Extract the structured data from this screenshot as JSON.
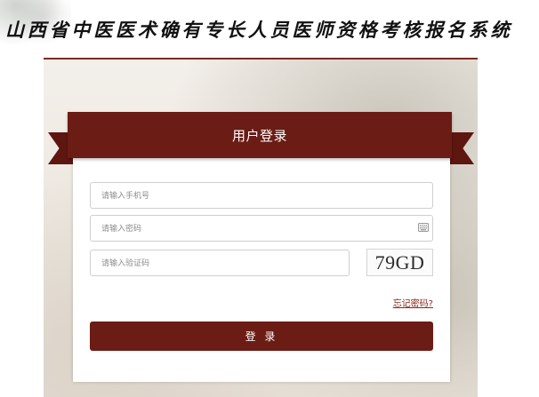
{
  "header": {
    "title": "山西省中医医术确有专长人员医师资格考核报名系统"
  },
  "login": {
    "title": "用户登录",
    "phone_placeholder": "请输入手机号",
    "password_placeholder": "请输入密码",
    "captcha_placeholder": "请输入验证码",
    "captcha_code": "79GD",
    "forgot_password": "忘记密码?",
    "submit_label": "登 录"
  },
  "colors": {
    "brand": "#6b1c15",
    "link": "#8a2a1f",
    "background": "#ffffff"
  },
  "icons": {
    "password_field": "keyboard-icon",
    "header_decoration": "ink-painting-decoration"
  }
}
